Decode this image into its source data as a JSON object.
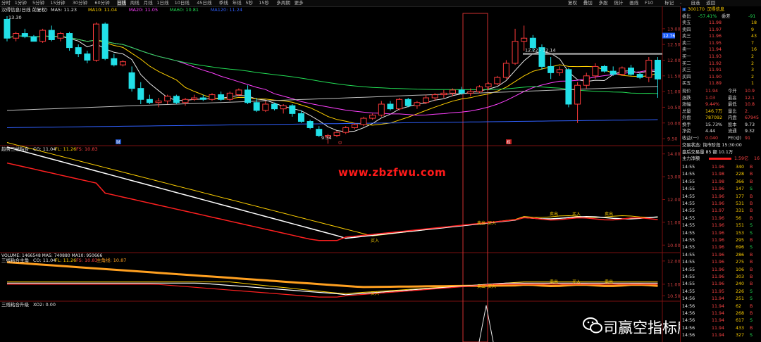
{
  "toolbar": {
    "left": [
      "分时",
      "1分钟",
      "5分钟",
      "15分钟",
      "30分钟",
      "60分钟",
      "日线",
      "周线",
      "月线",
      "1日线",
      "10日线",
      "45日线",
      "季线",
      "年线",
      "5秒",
      "15秒",
      "多周期",
      "更多"
    ],
    "right": [
      "复权",
      "叠加",
      "多股",
      "统计",
      "画线",
      "F10",
      "标记",
      "-",
      "自选",
      "返回"
    ]
  },
  "main": {
    "title": "汉得信息(日线 前复权)",
    "ma": [
      {
        "label": "MA5: 11.23",
        "color": "#e8e8e8"
      },
      {
        "label": "MA10: 11.04",
        "color": "#ffd000"
      },
      {
        "label": "MA20: 11.05",
        "color": "#ff40ff"
      },
      {
        "label": "MA60: 10.81",
        "color": "#22dd55"
      },
      {
        "label": "MA120: 11.24",
        "color": "#3060ff"
      }
    ],
    "price_top": "13.30",
    "low_label": "9.34",
    "tag_12": "12.22 - 12.14",
    "price_badge": "12.76",
    "left_marker": "财",
    "mid_marker": "中",
    "right_marker": "权",
    "y_ticks": [
      "13.00",
      "12.50",
      "12.00",
      "11.50",
      "11.00",
      "10.50",
      "10.00",
      "9.50"
    ]
  },
  "ind1": {
    "title": "趋势三线粘合",
    "co": "CO: 11.04",
    "fl": "FL: 11.26",
    "fs": "FS: 10.83",
    "buy_label": "买入",
    "sell_label": "卖出",
    "y_ticks": [
      "14.00",
      "13.00",
      "12.00",
      "11.00",
      "10.00"
    ]
  },
  "ind2": {
    "volume": "VOLUME: 1466548 MA5: 740880 MA10: 950666",
    "title": "三线粘合主角",
    "co": "CO: 11.04",
    "fl": "FL: 11.26",
    "fs": "FS: 10.83",
    "main_line": "主角线: 10.87",
    "buy_label": "买入",
    "sell_label": "卖出",
    "y_ticks": [
      "12.00",
      "11.00",
      "10.50"
    ]
  },
  "ind3": {
    "title": "三线粘合升级",
    "xo": "XO2: 0.00"
  },
  "chart_data": {
    "type": "candlestick",
    "candles": [
      {
        "o": 13.3,
        "h": 13.4,
        "l": 12.6,
        "c": 12.7
      },
      {
        "o": 12.7,
        "h": 12.9,
        "l": 12.6,
        "c": 12.85
      },
      {
        "o": 12.85,
        "h": 13.0,
        "l": 12.7,
        "c": 12.75
      },
      {
        "o": 12.75,
        "h": 12.8,
        "l": 12.6,
        "c": 12.6
      },
      {
        "o": 12.6,
        "h": 13.0,
        "l": 12.55,
        "c": 12.95
      },
      {
        "o": 12.95,
        "h": 13.1,
        "l": 12.6,
        "c": 12.65
      },
      {
        "o": 12.7,
        "h": 12.9,
        "l": 12.6,
        "c": 12.85
      },
      {
        "o": 12.85,
        "h": 12.9,
        "l": 12.3,
        "c": 12.4
      },
      {
        "o": 12.4,
        "h": 12.5,
        "l": 12.1,
        "c": 12.2
      },
      {
        "o": 12.2,
        "h": 12.3,
        "l": 11.9,
        "c": 12.0
      },
      {
        "o": 12.0,
        "h": 13.2,
        "l": 11.95,
        "c": 13.15
      },
      {
        "o": 13.15,
        "h": 13.2,
        "l": 12.0,
        "c": 12.05
      },
      {
        "o": 12.05,
        "h": 12.2,
        "l": 11.8,
        "c": 11.85
      },
      {
        "o": 11.85,
        "h": 12.0,
        "l": 11.8,
        "c": 11.95
      },
      {
        "o": 11.6,
        "h": 11.8,
        "l": 11.0,
        "c": 11.1
      },
      {
        "o": 11.1,
        "h": 11.3,
        "l": 10.6,
        "c": 10.75
      },
      {
        "o": 10.75,
        "h": 10.9,
        "l": 10.6,
        "c": 10.65
      },
      {
        "o": 10.65,
        "h": 10.8,
        "l": 10.5,
        "c": 10.7
      },
      {
        "o": 10.7,
        "h": 10.9,
        "l": 10.6,
        "c": 10.85
      },
      {
        "o": 10.85,
        "h": 10.9,
        "l": 10.6,
        "c": 10.65
      },
      {
        "o": 10.65,
        "h": 10.8,
        "l": 10.55,
        "c": 10.75
      },
      {
        "o": 10.75,
        "h": 10.9,
        "l": 10.7,
        "c": 10.8
      },
      {
        "o": 10.8,
        "h": 10.9,
        "l": 10.7,
        "c": 10.75
      },
      {
        "o": 10.75,
        "h": 10.95,
        "l": 10.7,
        "c": 10.9
      },
      {
        "o": 10.9,
        "h": 11.0,
        "l": 10.7,
        "c": 10.75
      },
      {
        "o": 10.75,
        "h": 11.0,
        "l": 10.7,
        "c": 10.95
      },
      {
        "o": 10.9,
        "h": 11.1,
        "l": 10.85,
        "c": 11.05
      },
      {
        "o": 11.05,
        "h": 11.2,
        "l": 10.6,
        "c": 10.65
      },
      {
        "o": 10.65,
        "h": 10.8,
        "l": 10.35,
        "c": 10.4
      },
      {
        "o": 10.4,
        "h": 10.7,
        "l": 10.35,
        "c": 10.6
      },
      {
        "o": 10.6,
        "h": 10.65,
        "l": 10.4,
        "c": 10.45
      },
      {
        "o": 10.45,
        "h": 10.6,
        "l": 10.3,
        "c": 10.55
      },
      {
        "o": 10.55,
        "h": 10.6,
        "l": 10.2,
        "c": 10.3
      },
      {
        "o": 10.3,
        "h": 10.4,
        "l": 10.0,
        "c": 10.05
      },
      {
        "o": 10.05,
        "h": 10.1,
        "l": 9.8,
        "c": 9.85
      },
      {
        "o": 9.8,
        "h": 9.9,
        "l": 9.55,
        "c": 9.6
      },
      {
        "o": 9.55,
        "h": 9.65,
        "l": 9.34,
        "c": 9.6
      },
      {
        "o": 9.6,
        "h": 9.75,
        "l": 9.55,
        "c": 9.7
      },
      {
        "o": 9.7,
        "h": 9.9,
        "l": 9.65,
        "c": 9.85
      },
      {
        "o": 9.85,
        "h": 10.0,
        "l": 9.8,
        "c": 9.95
      },
      {
        "o": 9.95,
        "h": 10.2,
        "l": 9.9,
        "c": 10.15
      },
      {
        "o": 10.15,
        "h": 10.3,
        "l": 10.1,
        "c": 10.25
      },
      {
        "o": 10.25,
        "h": 10.7,
        "l": 10.2,
        "c": 10.6
      },
      {
        "o": 10.6,
        "h": 10.7,
        "l": 10.4,
        "c": 10.45
      },
      {
        "o": 10.45,
        "h": 10.8,
        "l": 10.4,
        "c": 10.75
      },
      {
        "o": 10.75,
        "h": 10.8,
        "l": 10.5,
        "c": 10.55
      },
      {
        "o": 10.55,
        "h": 10.7,
        "l": 10.45,
        "c": 10.65
      },
      {
        "o": 10.65,
        "h": 10.9,
        "l": 10.6,
        "c": 10.8
      },
      {
        "o": 10.8,
        "h": 10.95,
        "l": 10.7,
        "c": 10.9
      },
      {
        "o": 10.9,
        "h": 11.05,
        "l": 10.8,
        "c": 10.95
      },
      {
        "o": 10.95,
        "h": 11.1,
        "l": 10.85,
        "c": 11.05
      },
      {
        "o": 11.05,
        "h": 11.15,
        "l": 10.9,
        "c": 10.95
      },
      {
        "o": 10.95,
        "h": 11.1,
        "l": 10.85,
        "c": 11.0
      },
      {
        "o": 11.0,
        "h": 11.2,
        "l": 10.95,
        "c": 11.15
      },
      {
        "o": 11.15,
        "h": 11.3,
        "l": 11.05,
        "c": 11.25
      },
      {
        "o": 11.25,
        "h": 11.5,
        "l": 11.2,
        "c": 11.45
      },
      {
        "o": 11.45,
        "h": 12.0,
        "l": 11.4,
        "c": 11.9
      },
      {
        "o": 11.9,
        "h": 13.0,
        "l": 11.85,
        "c": 12.6
      },
      {
        "o": 12.6,
        "h": 13.1,
        "l": 12.3,
        "c": 12.7
      },
      {
        "o": 12.7,
        "h": 12.8,
        "l": 12.3,
        "c": 12.4
      },
      {
        "o": 12.4,
        "h": 12.5,
        "l": 11.7,
        "c": 11.8
      },
      {
        "o": 11.8,
        "h": 12.1,
        "l": 11.4,
        "c": 11.6
      },
      {
        "o": 11.6,
        "h": 11.8,
        "l": 11.5,
        "c": 11.7
      },
      {
        "o": 11.7,
        "h": 11.75,
        "l": 10.5,
        "c": 10.6
      },
      {
        "o": 10.6,
        "h": 11.3,
        "l": 10.0,
        "c": 11.2
      },
      {
        "o": 11.2,
        "h": 11.6,
        "l": 11.1,
        "c": 11.5
      },
      {
        "o": 11.5,
        "h": 11.9,
        "l": 11.4,
        "c": 11.8
      },
      {
        "o": 11.8,
        "h": 11.85,
        "l": 11.6,
        "c": 11.65
      },
      {
        "o": 11.65,
        "h": 11.8,
        "l": 11.5,
        "c": 11.55
      },
      {
        "o": 11.55,
        "h": 11.8,
        "l": 11.5,
        "c": 11.75
      },
      {
        "o": 11.75,
        "h": 11.85,
        "l": 11.5,
        "c": 11.55
      },
      {
        "o": 11.55,
        "h": 11.6,
        "l": 11.4,
        "c": 11.45
      },
      {
        "o": 11.45,
        "h": 12.1,
        "l": 11.3,
        "c": 12.0
      },
      {
        "o": 12.0,
        "h": 12.1,
        "l": 10.8,
        "c": 11.4
      }
    ],
    "ylim": [
      9.3,
      13.4
    ]
  },
  "right": {
    "code": "300170",
    "name": "汉得信息",
    "wb_label": "委比",
    "wb": "-57.41%",
    "wc_label": "委差",
    "wc": "-91",
    "asks": [
      {
        "label": "卖五",
        "price": "11.98",
        "vol": "18"
      },
      {
        "label": "卖四",
        "price": "11.97",
        "vol": "9"
      },
      {
        "label": "卖三",
        "price": "11.96",
        "vol": "43"
      },
      {
        "label": "卖二",
        "price": "11.95",
        "vol": "7"
      },
      {
        "label": "卖一",
        "price": "11.94",
        "vol": "16"
      }
    ],
    "bids": [
      {
        "label": "买一",
        "price": "11.93",
        "vol": "2"
      },
      {
        "label": "买二",
        "price": "11.92",
        "vol": "2"
      },
      {
        "label": "买三",
        "price": "11.91",
        "vol": "3"
      },
      {
        "label": "买四",
        "price": "11.90",
        "vol": "2"
      },
      {
        "label": "买五",
        "price": "11.89",
        "vol": "1"
      }
    ],
    "stats": [
      {
        "l1": "现价",
        "v1": "11.94",
        "l2": "今开",
        "v2": "10.9"
      },
      {
        "l1": "涨跌",
        "v1": "1.03",
        "l2": "最高",
        "v2": "12.1"
      },
      {
        "l1": "涨幅",
        "v1": "9.44%",
        "l2": "最低",
        "v2": "10.8"
      },
      {
        "l1": "总量",
        "v1": "146.7万",
        "l2": "量比",
        "v2": "2."
      },
      {
        "l1": "外盘",
        "v1": "787092",
        "l2": "内盘",
        "v2": "67945"
      },
      {
        "l1": "换手",
        "v1": "15.73%",
        "l2": "股本",
        "v2": "9.73"
      },
      {
        "l1": "净资",
        "v1": "4.44",
        "l2": "流通",
        "v2": "9.32"
      },
      {
        "l1": "收益(一)",
        "v1": "0.040",
        "l2": "PE(动)",
        "v2": "91"
      }
    ],
    "trade_status": "交易状态: 询市阶段 15:30:00",
    "after_hours": "盘后交易量 85 额 10.1万",
    "main_tab": "主力净额",
    "main_val": "1.59亿",
    "main_val2": "16",
    "ticks": [
      {
        "t": "14:55",
        "p": "11.96",
        "v": "340",
        "d": "B"
      },
      {
        "t": "14:55",
        "p": "11.98",
        "v": "228",
        "d": "B"
      },
      {
        "t": "14:55",
        "p": "11.98",
        "v": "366",
        "d": "B"
      },
      {
        "t": "14:55",
        "p": "11.96",
        "v": "147",
        "d": "S"
      },
      {
        "t": "14:55",
        "p": "11.96",
        "v": "177",
        "d": "B"
      },
      {
        "t": "14:55",
        "p": "11.96",
        "v": "531",
        "d": "B"
      },
      {
        "t": "14:55",
        "p": "11.97",
        "v": "331",
        "d": "B"
      },
      {
        "t": "14:55",
        "p": "11.96",
        "v": "56",
        "d": "B"
      },
      {
        "t": "14:55",
        "p": "11.96",
        "v": "151",
        "d": "S"
      },
      {
        "t": "14:55",
        "p": "11.96",
        "v": "153",
        "d": "S"
      },
      {
        "t": "14:55",
        "p": "11.96",
        "v": "295",
        "d": "B"
      },
      {
        "t": "14:55",
        "p": "11.96",
        "v": "696",
        "d": "S"
      },
      {
        "t": "14:55",
        "p": "11.96",
        "v": "286",
        "d": "B"
      },
      {
        "t": "14:55",
        "p": "11.96",
        "v": "275",
        "d": "B"
      },
      {
        "t": "14:55",
        "p": "11.96",
        "v": "106",
        "d": "B"
      },
      {
        "t": "14:55",
        "p": "11.96",
        "v": "303",
        "d": "B"
      },
      {
        "t": "14:55",
        "p": "11.96",
        "v": "240",
        "d": "B"
      },
      {
        "t": "14:55",
        "p": "11.95",
        "v": "226",
        "d": "S"
      },
      {
        "t": "14:56",
        "p": "11.94",
        "v": "251",
        "d": "S"
      },
      {
        "t": "14:56",
        "p": "11.94",
        "v": "62",
        "d": "B"
      },
      {
        "t": "14:56",
        "p": "11.94",
        "v": "268",
        "d": "B"
      },
      {
        "t": "14:56",
        "p": "11.94",
        "v": "617",
        "d": "S"
      },
      {
        "t": "14:56",
        "p": "11.94",
        "v": "433",
        "d": "B"
      },
      {
        "t": "14:56",
        "p": "11.94",
        "v": "327",
        "d": "S"
      }
    ]
  },
  "watermark": "www.zbzfwu.com",
  "brand": "司赢空指标所"
}
